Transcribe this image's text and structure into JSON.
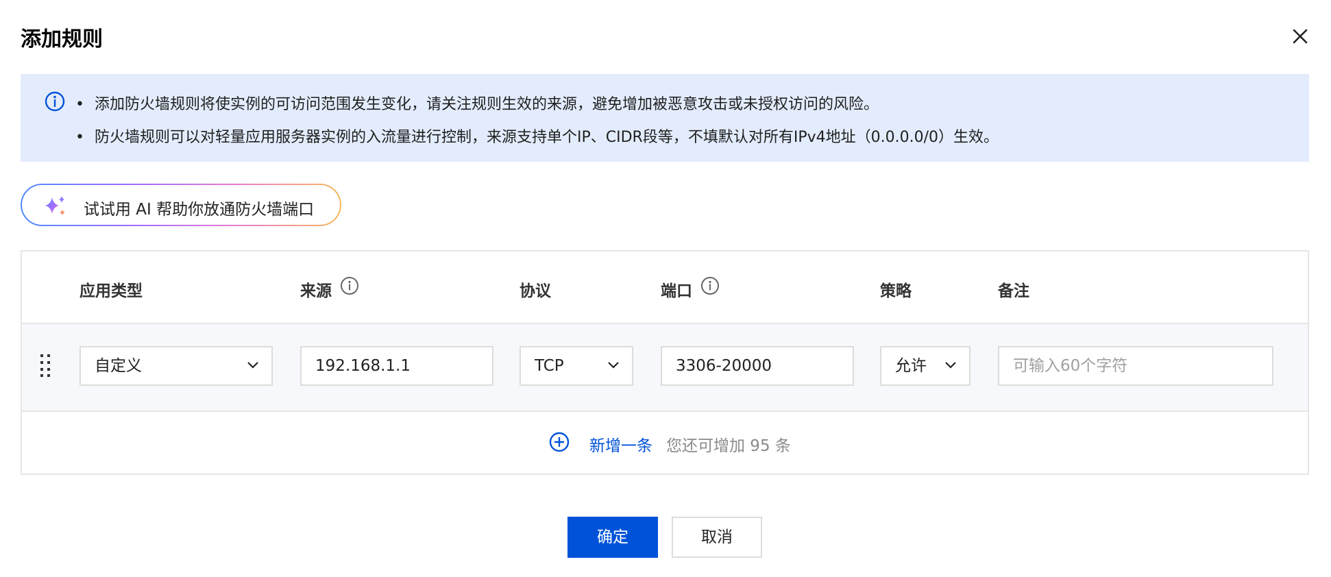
{
  "dialog": {
    "title": "添加规则",
    "close_icon": "close-icon"
  },
  "notice": {
    "icon": "info-icon",
    "lines": [
      "添加防火墙规则将使实例的可访问范围发生变化，请关注规则生效的来源，避免增加被恶意攻击或未授权访问的风险。",
      "防火墙规则可以对轻量应用服务器实例的入流量进行控制，来源支持单个IP、CIDR段等，不填默认对所有IPv4地址（0.0.0.0/0）生效。"
    ],
    "bullet": "•"
  },
  "ai_button": {
    "icon": "sparkle-icon",
    "label": "试试用 AI 帮助你放通防火墙端口"
  },
  "table": {
    "headers": {
      "app_type": "应用类型",
      "source": "来源",
      "protocol": "协议",
      "port": "端口",
      "policy": "策略",
      "remark": "备注"
    },
    "row": {
      "app_type": "自定义",
      "source": "192.168.1.1",
      "protocol": "TCP",
      "port": "3306-20000",
      "policy": "允许",
      "remark_placeholder": "可输入60个字符"
    },
    "add_label": "新增一条",
    "add_hint": "您还可增加 95 条"
  },
  "footer": {
    "confirm": "确定",
    "cancel": "取消"
  },
  "colors": {
    "primary": "#0052d9",
    "notice_bg": "#e3ecfd"
  }
}
